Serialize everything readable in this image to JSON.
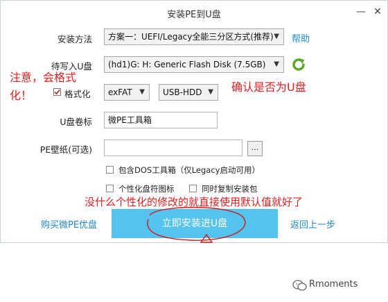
{
  "window": {
    "title": "安装PE到U盘",
    "minimize": "—",
    "close": "✕"
  },
  "form": {
    "install_method_label": "安装方法",
    "install_method_value": "方案一：UEFI/Legacy全能三分区方式(推荐)",
    "help_link": "帮助",
    "target_label": "待写入U盘",
    "target_value": "(hd1)G: H: Generic Flash Disk (7.5GB)",
    "format_label": "格式化",
    "fs_value": "exFAT",
    "mode_value": "USB-HDD",
    "volume_label": "U盘卷标",
    "volume_value": "微PE工具箱",
    "wallpaper_label": "PE壁纸(可选)",
    "wallpaper_value": "",
    "browse_label": "...",
    "dos_tools_label": "包含DOS工具箱（仅Legacy启动可用）",
    "custom_icon_label": "个性化盘符图标",
    "copy_installer_label": "同时复制安装包"
  },
  "footer": {
    "buy_link": "购买微PE优盘",
    "install_button": "立即安装进U盘",
    "back_link": "返回上一步"
  },
  "annotations": {
    "format_note_line1": "注意，会格式",
    "format_note_line2": "化！",
    "confirm_note": "确认是否为U盘",
    "default_note": "没什么个性化的修改的就直接使用默认值就好了"
  },
  "brand": {
    "name": "Rmoments"
  },
  "colors": {
    "accent": "#55c3f0",
    "link": "#1e88c8",
    "annotation": "#e02020"
  }
}
